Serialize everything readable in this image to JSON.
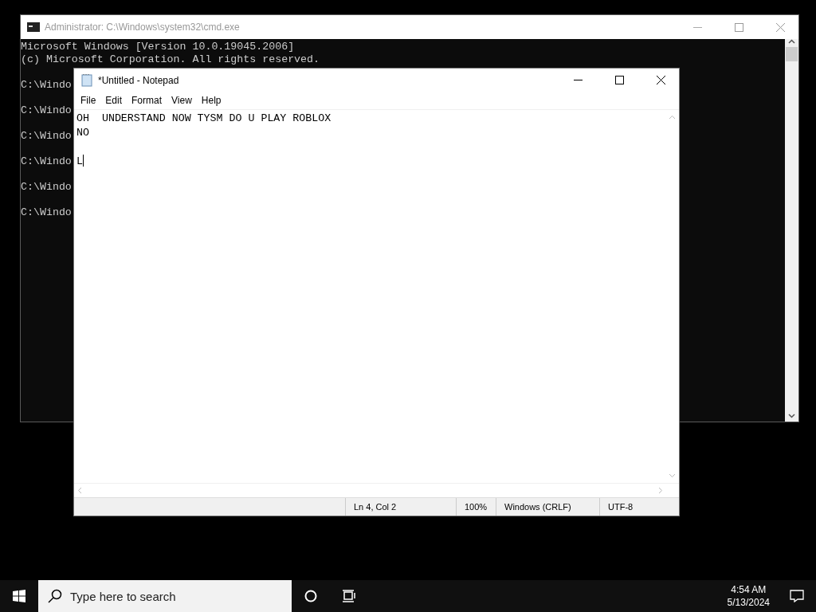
{
  "cmd": {
    "title": "Administrator: C:\\Windows\\system32\\cmd.exe",
    "header": [
      "Microsoft Windows [Version 10.0.19045.2006]",
      "(c) Microsoft Corporation. All rights reserved."
    ],
    "prompts": [
      "C:\\Windo",
      "C:\\Windo",
      "C:\\Windo",
      "C:\\Windo",
      "C:\\Windo",
      "C:\\Windo"
    ]
  },
  "notepad": {
    "title": "*Untitled - Notepad",
    "menu": [
      "File",
      "Edit",
      "Format",
      "View",
      "Help"
    ],
    "text": "OH  UNDERSTAND NOW TYSM DO U PLAY ROBLOX\nNO\n\nL",
    "status": [
      "Ln 4, Col 2",
      "100%",
      "Windows (CRLF)",
      "UTF-8"
    ]
  },
  "taskbar": {
    "search": {
      "placeholder": "Type here to search"
    },
    "time": "4:54 AM",
    "date": "5/13/2024"
  }
}
